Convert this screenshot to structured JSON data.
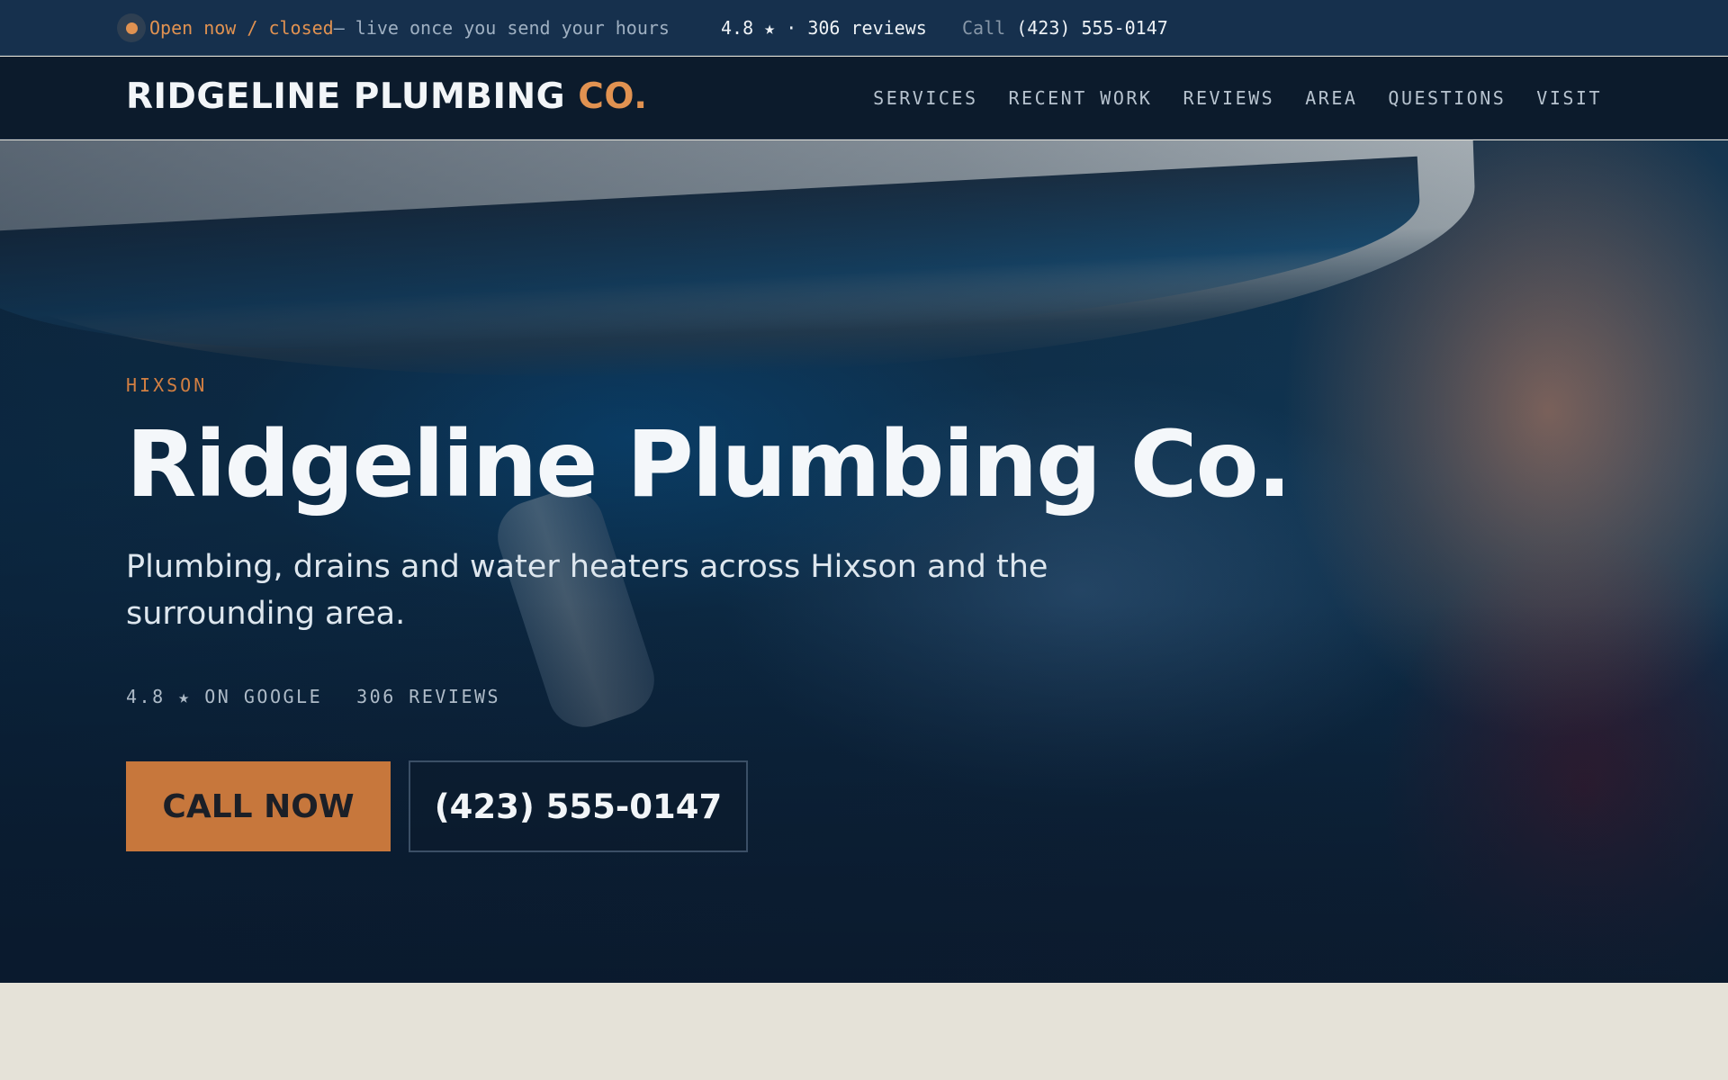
{
  "topbar": {
    "status_open": "Open now / closed",
    "status_note": " — live once you send your hours",
    "rating": "4.8 ★ · 306 reviews",
    "call_label": "Call",
    "call_number": "(423) 555-0147",
    "status_dot_color": "#e19251"
  },
  "nav": {
    "brand_main": "RIDGELINE PLUMBING",
    "brand_accent": "CO.",
    "links": [
      "SERVICES",
      "RECENT WORK",
      "REVIEWS",
      "AREA",
      "QUESTIONS",
      "VISIT"
    ]
  },
  "hero": {
    "eyebrow": "HIXSON",
    "title": "Ridgeline Plumbing Co.",
    "subtitle": "Plumbing, drains and water heaters across Hixson and the surrounding area.",
    "meta_rating": "4.8 ★ ON GOOGLE",
    "meta_reviews": "306 REVIEWS",
    "cta_call": "CALL NOW",
    "cta_phone": "(423) 555-0147"
  },
  "colors": {
    "accent": "#e19251",
    "cta": "#c7773c",
    "navy": "#0c1b2c",
    "page_bg": "#e5e2d8"
  }
}
